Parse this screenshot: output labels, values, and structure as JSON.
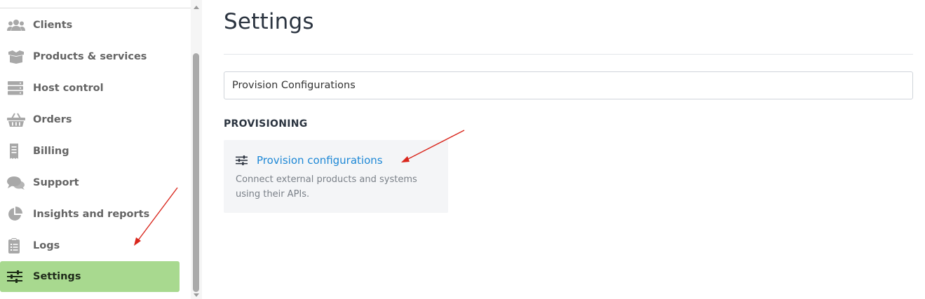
{
  "sidebar": {
    "items": [
      {
        "label": "Clients",
        "icon": "users-icon"
      },
      {
        "label": "Products & services",
        "icon": "box-icon"
      },
      {
        "label": "Host control",
        "icon": "server-icon"
      },
      {
        "label": "Orders",
        "icon": "basket-icon"
      },
      {
        "label": "Billing",
        "icon": "receipt-icon"
      },
      {
        "label": "Support",
        "icon": "chat-bubbles-icon"
      },
      {
        "label": "Insights and reports",
        "icon": "pie-chart-icon"
      },
      {
        "label": "Logs",
        "icon": "clipboard-icon"
      },
      {
        "label": "Settings",
        "icon": "sliders-icon",
        "active": true
      }
    ]
  },
  "main": {
    "title": "Settings",
    "search": {
      "value": "Provision Configurations"
    },
    "section_heading": "PROVISIONING",
    "card": {
      "title": "Provision configurations",
      "description": "Connect external products and systems using their APIs.",
      "icon": "sliders-icon"
    }
  },
  "colors": {
    "active_bg": "#a8d98f",
    "link": "#1e88d6",
    "annotation_arrow": "#d9261c"
  }
}
